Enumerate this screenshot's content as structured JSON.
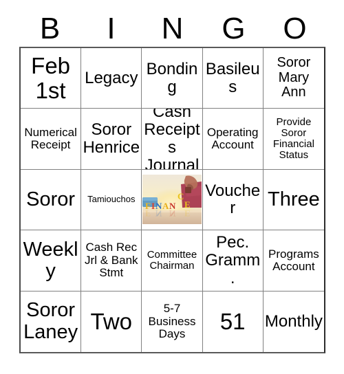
{
  "card": {
    "title": "BINGO card",
    "header_letters": [
      "B",
      "I",
      "N",
      "G",
      "O"
    ],
    "rows": [
      [
        {
          "text": "Feb\n1st",
          "size": "xxl"
        },
        {
          "text": "Legacy",
          "size": "lg"
        },
        {
          "text": "Bonding",
          "size": "lg"
        },
        {
          "text": "Basileus",
          "size": "lg"
        },
        {
          "text": "Soror\nMary\nAnn",
          "size": "md"
        }
      ],
      [
        {
          "text": "Numerical\nReceipt",
          "size": "sm"
        },
        {
          "text": "Soror\nHenrice",
          "size": "lg"
        },
        {
          "text": "Cash\nReceipts\nJournal",
          "size": "lg"
        },
        {
          "text": "Operating\nAccount",
          "size": "sm"
        },
        {
          "text": "Provide\nSoror\nFinancial\nStatus",
          "size": "xs"
        }
      ],
      [
        {
          "text": "Soror",
          "size": "xl"
        },
        {
          "text": "Tamiouchos",
          "size": "xxs"
        },
        {
          "text": "",
          "size": "md",
          "image": "finance-blocks-photo"
        },
        {
          "text": "Voucher",
          "size": "lg"
        },
        {
          "text": "Three",
          "size": "xl"
        }
      ],
      [
        {
          "text": "Weekly",
          "size": "xl"
        },
        {
          "text": "Cash Rec\nJrl & Bank\nStmt",
          "size": "sm"
        },
        {
          "text": "Committee\nChairman",
          "size": "xs"
        },
        {
          "text": "Pec.\nGramm.",
          "size": "lg"
        },
        {
          "text": "Programs\nAccount",
          "size": "sm"
        }
      ],
      [
        {
          "text": "Soror\nLaney",
          "size": "xl"
        },
        {
          "text": "Two",
          "size": "xxl"
        },
        {
          "text": "5-7\nBusiness\nDays",
          "size": "sm"
        },
        {
          "text": "51",
          "size": "xxl"
        },
        {
          "text": "Monthly",
          "size": "lg"
        }
      ]
    ]
  },
  "image_cell": {
    "alt": "FINANCE spelled with colored blocks, a hand placing a block",
    "word_letters": [
      "F",
      "I",
      "N",
      "A",
      "N",
      "C",
      "E"
    ],
    "letter_colors": [
      "#f0b71e",
      "#d8402c",
      "#2f6fc0",
      "#e8b01c",
      "#c8372a",
      "#e8c21c",
      "#e8c21c"
    ],
    "colors": {
      "sky": "#f3ede2",
      "glow": "#f7e8b0",
      "blue_block": "#4a8fc0",
      "red_block": "#a8384f",
      "hand": "#b06a58",
      "floor": "#d9c2ae"
    }
  },
  "colors": {
    "background": "#ffffff",
    "text": "#000000",
    "grid_line": "#808080",
    "grid_border": "#4a4a4a"
  }
}
